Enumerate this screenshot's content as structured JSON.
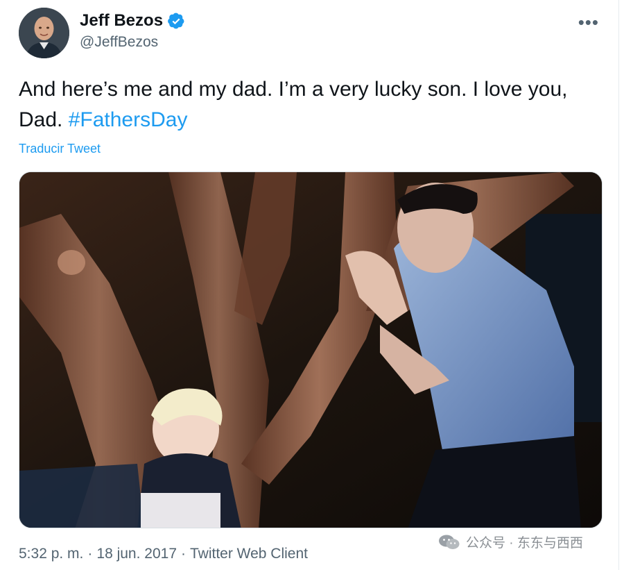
{
  "author": {
    "display_name": "Jeff Bezos",
    "handle": "@JeffBezos",
    "verified": true
  },
  "tweet": {
    "text_main": "And here’s me and my dad. I’m a very lucky son. I love you, Dad.",
    "hashtag": "#FathersDay",
    "translate_label": "Traducir Tweet",
    "more_label": "•••"
  },
  "meta": {
    "time": "5:32 p. m.",
    "separator": "·",
    "date": "18 jun. 2017",
    "client": "Twitter Web Client"
  },
  "watermark": {
    "text": "公众号 · 东东与西西"
  },
  "colors": {
    "accent": "#1d9bf0",
    "text": "#0f1419",
    "muted": "#536471"
  }
}
